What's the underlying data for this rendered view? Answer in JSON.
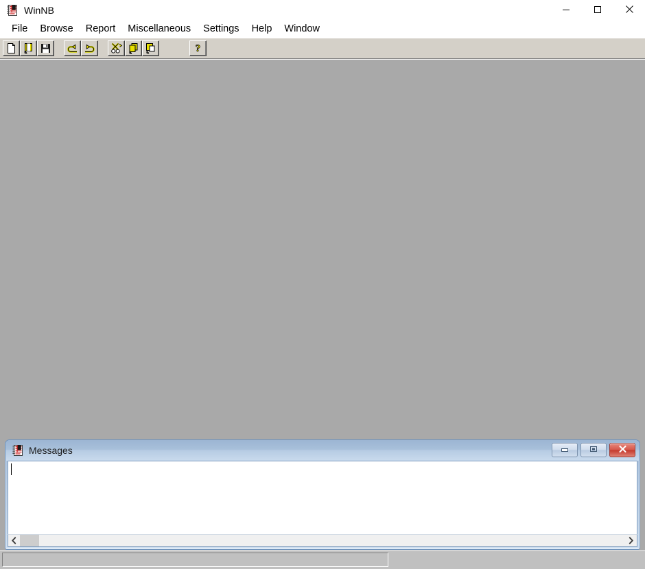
{
  "window": {
    "title": "WinNB",
    "icon": "notebook-icon",
    "controls": [
      {
        "name": "minimize",
        "glyph": "—"
      },
      {
        "name": "maximize",
        "glyph": "□"
      },
      {
        "name": "close",
        "glyph": "✕"
      }
    ]
  },
  "menu": {
    "items": [
      {
        "label": "File"
      },
      {
        "label": "Browse"
      },
      {
        "label": "Report"
      },
      {
        "label": "Miscellaneous"
      },
      {
        "label": "Settings"
      },
      {
        "label": "Help"
      },
      {
        "label": "Window"
      }
    ]
  },
  "toolbar": {
    "groups": [
      {
        "buttons": [
          {
            "name": "new-file-button",
            "icon": "new-document-icon",
            "tooltip": "New"
          },
          {
            "name": "open-file-button",
            "icon": "open-folder-icon",
            "tooltip": "Open"
          },
          {
            "name": "save-file-button",
            "icon": "floppy-disk-icon",
            "tooltip": "Save"
          }
        ]
      },
      {
        "buttons": [
          {
            "name": "undo-button",
            "icon": "undo-arrow-icon",
            "tooltip": "Undo"
          },
          {
            "name": "redo-button",
            "icon": "redo-arrow-icon",
            "tooltip": "Redo"
          }
        ]
      },
      {
        "buttons": [
          {
            "name": "cut-button",
            "icon": "scissors-icon",
            "tooltip": "Cut"
          },
          {
            "name": "copy-button",
            "icon": "copy-documents-icon",
            "tooltip": "Copy"
          },
          {
            "name": "paste-button",
            "icon": "paste-clipboard-icon",
            "tooltip": "Paste"
          }
        ]
      },
      {
        "buttons": [
          {
            "name": "help-button",
            "icon": "question-mark-icon",
            "tooltip": "Help"
          }
        ]
      }
    ]
  },
  "mdi": {
    "child_window": {
      "title": "Messages",
      "icon": "notebook-icon",
      "controls": [
        {
          "name": "minimize",
          "glyph": "minimize-glyph"
        },
        {
          "name": "restore",
          "glyph": "restore-glyph"
        },
        {
          "name": "close",
          "glyph": "close-glyph"
        }
      ],
      "text_content": "",
      "scrollbar": {
        "left_arrow": "‹",
        "right_arrow": "›"
      }
    }
  },
  "status_bar": {
    "panels": [
      {
        "name": "status-panel-message",
        "text": ""
      }
    ]
  },
  "colors": {
    "mdi_background": "#a9a9a9",
    "toolbar_face": "#d4d0c8",
    "status_face": "#c0c0c0",
    "child_frame": "#6e93bd",
    "close_button": "#c4392c",
    "icon_yellow": "#ffff00"
  }
}
